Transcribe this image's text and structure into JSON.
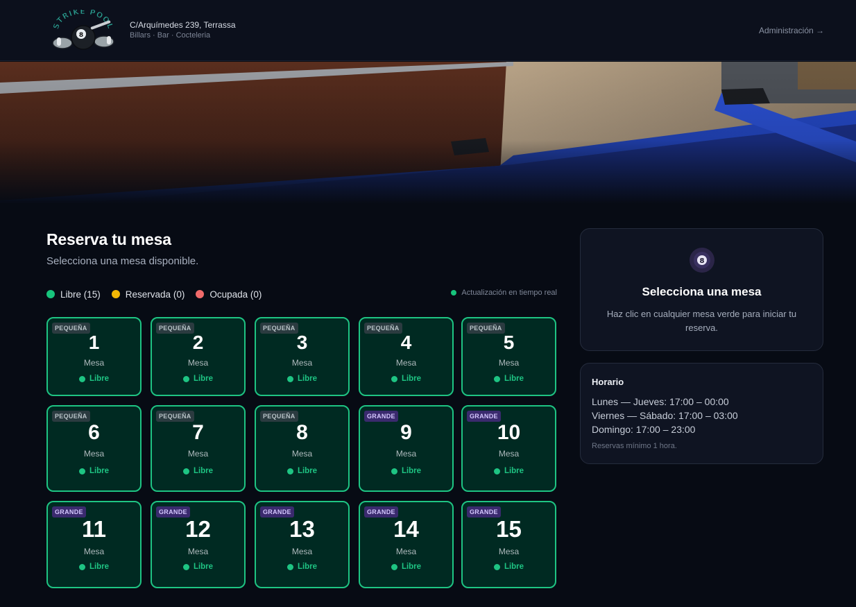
{
  "header": {
    "logo_text": "STRIKE POOL",
    "address": "C/Arquímedes 239, Terrassa",
    "tagline": "Billars · Bar · Cocteleria",
    "admin_link": "Administración →"
  },
  "main": {
    "title": "Reserva tu mesa",
    "subtitle": "Selecciona una mesa disponible.",
    "legend": [
      {
        "label": "Libre (15)",
        "color": "#17c47c"
      },
      {
        "label": "Reservada (0)",
        "color": "#f2b705"
      },
      {
        "label": "Ocupada (0)",
        "color": "#f06a6a"
      }
    ],
    "realtime_label": "Actualización en tiempo real",
    "tables": [
      {
        "number": "1",
        "size": "PEQUEÑA",
        "label": "Mesa",
        "status": "Libre"
      },
      {
        "number": "2",
        "size": "PEQUEÑA",
        "label": "Mesa",
        "status": "Libre"
      },
      {
        "number": "3",
        "size": "PEQUEÑA",
        "label": "Mesa",
        "status": "Libre"
      },
      {
        "number": "4",
        "size": "PEQUEÑA",
        "label": "Mesa",
        "status": "Libre"
      },
      {
        "number": "5",
        "size": "PEQUEÑA",
        "label": "Mesa",
        "status": "Libre"
      },
      {
        "number": "6",
        "size": "PEQUEÑA",
        "label": "Mesa",
        "status": "Libre"
      },
      {
        "number": "7",
        "size": "PEQUEÑA",
        "label": "Mesa",
        "status": "Libre"
      },
      {
        "number": "8",
        "size": "PEQUEÑA",
        "label": "Mesa",
        "status": "Libre"
      },
      {
        "number": "9",
        "size": "GRANDE",
        "label": "Mesa",
        "status": "Libre"
      },
      {
        "number": "10",
        "size": "GRANDE",
        "label": "Mesa",
        "status": "Libre"
      },
      {
        "number": "11",
        "size": "GRANDE",
        "label": "Mesa",
        "status": "Libre"
      },
      {
        "number": "12",
        "size": "GRANDE",
        "label": "Mesa",
        "status": "Libre"
      },
      {
        "number": "13",
        "size": "GRANDE",
        "label": "Mesa",
        "status": "Libre"
      },
      {
        "number": "14",
        "size": "GRANDE",
        "label": "Mesa",
        "status": "Libre"
      },
      {
        "number": "15",
        "size": "GRANDE",
        "label": "Mesa",
        "status": "Libre"
      }
    ]
  },
  "sidebar": {
    "select_icon": "8-ball-icon",
    "select_title": "Selecciona una mesa",
    "select_desc": "Haz clic en cualquier mesa verde para iniciar tu reserva.",
    "hours_title": "Horario",
    "hours": [
      "Lunes — Jueves: 17:00 – 00:00",
      "Viernes — Sábado: 17:00 – 03:00",
      "Domingo: 17:00 – 23:00"
    ],
    "hours_note": "Reservas mínimo 1 hora."
  },
  "colors": {
    "free": "#17c47c",
    "reserved": "#f2b705",
    "occupied": "#f06a6a",
    "card_bg": "#002a22",
    "badge_small": "#2b3b40",
    "badge_large": "#3a2a6e"
  }
}
